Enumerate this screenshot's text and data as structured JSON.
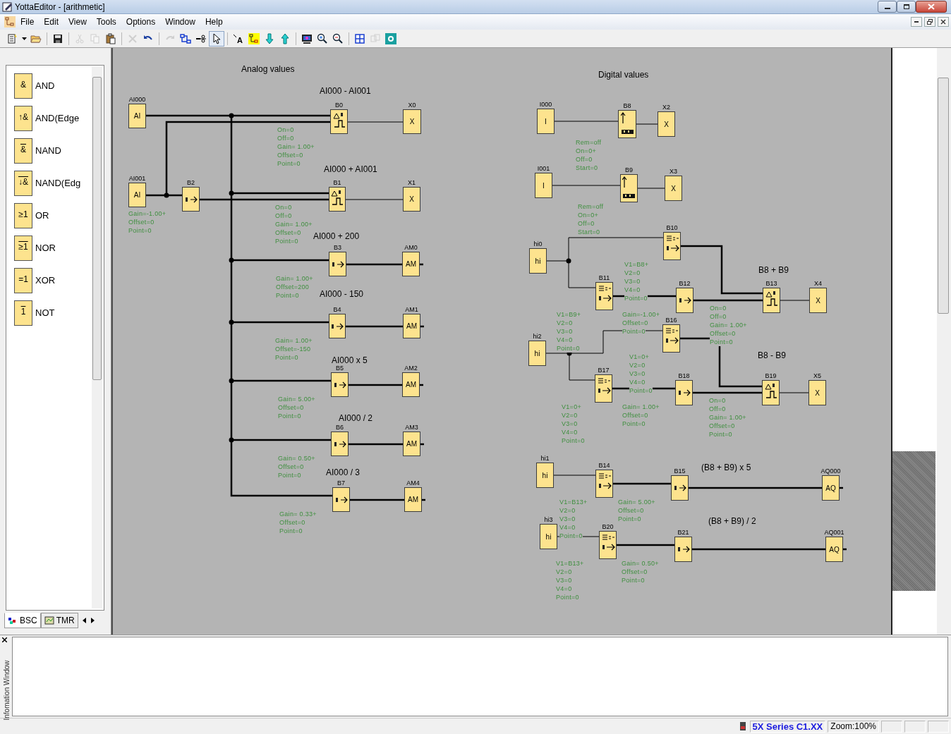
{
  "window": {
    "title": "YottaEditor - [arithmetic]"
  },
  "menu": [
    "File",
    "Edit",
    "View",
    "Tools",
    "Options",
    "Window",
    "Help"
  ],
  "toolbar": [
    {
      "kind": "new",
      "disabled": false
    },
    {
      "kind": "open",
      "disabled": false
    },
    {
      "kind": "save",
      "disabled": false
    },
    {
      "kind": "cut",
      "disabled": true
    },
    {
      "kind": "copy",
      "disabled": true
    },
    {
      "kind": "paste",
      "disabled": false
    },
    {
      "kind": "delete",
      "disabled": true
    },
    {
      "kind": "undo",
      "disabled": false
    },
    {
      "kind": "redo",
      "disabled": true
    },
    {
      "kind": "connect",
      "disabled": false
    },
    {
      "kind": "wirecut",
      "disabled": false
    },
    {
      "kind": "pointer",
      "disabled": false,
      "selected": true
    },
    {
      "kind": "text",
      "disabled": false,
      "glyph": "A"
    },
    {
      "kind": "block",
      "disabled": false
    },
    {
      "kind": "download",
      "disabled": false
    },
    {
      "kind": "upload",
      "disabled": false
    },
    {
      "kind": "monitor",
      "disabled": false
    },
    {
      "kind": "zoomin",
      "disabled": false
    },
    {
      "kind": "zoomout",
      "disabled": false
    },
    {
      "kind": "grid",
      "disabled": false
    },
    {
      "kind": "simulate",
      "disabled": true
    },
    {
      "kind": "settings",
      "disabled": false
    }
  ],
  "palette": {
    "items": [
      {
        "symbol": "&",
        "label": "AND",
        "negated": false
      },
      {
        "symbol": "↑&",
        "label": "AND(Edge",
        "negated": false
      },
      {
        "symbol": "&",
        "label": "NAND",
        "negated": true
      },
      {
        "symbol": "↓&",
        "label": "NAND(Edg",
        "negated": true
      },
      {
        "symbol": "≥1",
        "label": "OR",
        "negated": false
      },
      {
        "symbol": "≥1",
        "label": "NOR",
        "negated": true
      },
      {
        "symbol": "=1",
        "label": "XOR",
        "negated": false
      },
      {
        "symbol": "1",
        "label": "NOT",
        "negated": true
      }
    ],
    "tabs": [
      {
        "label": "BSC",
        "selected": true
      },
      {
        "label": "TMR",
        "selected": false
      }
    ]
  },
  "canvas": {
    "headings": [
      "Analog values",
      "AI000 - AI001",
      "AI000 + AI001",
      "AI000 + 200",
      "AI000 - 150",
      "AI000 x  5",
      "AI000 / 2",
      "AI000 / 3",
      "Digital values",
      "B8 + B9",
      "B8 - B9",
      "(B8 + B9) x 5",
      "(B8 + B9) / 2"
    ],
    "blocks": [
      {
        "label": "AI000",
        "kind": "input",
        "text": "AI"
      },
      {
        "label": "B0",
        "kind": "threshold"
      },
      {
        "label": "X0",
        "kind": "output",
        "text": "X"
      },
      {
        "label": "AI001",
        "kind": "input",
        "text": "AI"
      },
      {
        "label": "B2",
        "kind": "amplifier"
      },
      {
        "label": "B1",
        "kind": "threshold"
      },
      {
        "label": "X1",
        "kind": "output",
        "text": "X"
      },
      {
        "label": "B3",
        "kind": "amplifier"
      },
      {
        "label": "AM0",
        "kind": "output",
        "text": "AM"
      },
      {
        "label": "B4",
        "kind": "amplifier"
      },
      {
        "label": "AM1",
        "kind": "output",
        "text": "AM"
      },
      {
        "label": "B5",
        "kind": "amplifier"
      },
      {
        "label": "AM2",
        "kind": "output",
        "text": "AM"
      },
      {
        "label": "B6",
        "kind": "amplifier"
      },
      {
        "label": "AM3",
        "kind": "output",
        "text": "AM"
      },
      {
        "label": "B7",
        "kind": "amplifier"
      },
      {
        "label": "AM4",
        "kind": "output",
        "text": "AM"
      },
      {
        "label": "I000",
        "kind": "input",
        "text": "I"
      },
      {
        "label": "B8",
        "kind": "counter"
      },
      {
        "label": "X2",
        "kind": "output",
        "text": "X"
      },
      {
        "label": "I001",
        "kind": "input",
        "text": "I"
      },
      {
        "label": "B9",
        "kind": "counter"
      },
      {
        "label": "X3",
        "kind": "output",
        "text": "X"
      },
      {
        "label": "hi0",
        "kind": "input",
        "text": "hi"
      },
      {
        "label": "B10",
        "kind": "multiplexer"
      },
      {
        "label": "B11",
        "kind": "multiplexer"
      },
      {
        "label": "B12",
        "kind": "amplifier"
      },
      {
        "label": "B13",
        "kind": "threshold"
      },
      {
        "label": "X4",
        "kind": "output",
        "text": "X"
      },
      {
        "label": "hi2",
        "kind": "input",
        "text": "hi"
      },
      {
        "label": "B16",
        "kind": "multiplexer"
      },
      {
        "label": "B17",
        "kind": "multiplexer"
      },
      {
        "label": "B18",
        "kind": "amplifier"
      },
      {
        "label": "B19",
        "kind": "threshold"
      },
      {
        "label": "X5",
        "kind": "output",
        "text": "X"
      },
      {
        "label": "hi1",
        "kind": "input",
        "text": "hi"
      },
      {
        "label": "B14",
        "kind": "multiplexer"
      },
      {
        "label": "B15",
        "kind": "amplifier"
      },
      {
        "label": "AQ000",
        "kind": "output",
        "text": "AQ"
      },
      {
        "label": "hi3",
        "kind": "input",
        "text": "hi"
      },
      {
        "label": "B20",
        "kind": "multiplexer"
      },
      {
        "label": "B21",
        "kind": "amplifier"
      },
      {
        "label": "AQ001",
        "kind": "output",
        "text": "AQ"
      }
    ],
    "params": [
      {
        "lines": [
          "On=0",
          "Off=0",
          "Gain= 1.00+",
          "Offset=0",
          "Point=0"
        ]
      },
      {
        "lines": [
          "Gain=-1.00+",
          "Offset=0",
          "Point=0"
        ]
      },
      {
        "lines": [
          "On=0",
          "Off=0",
          "Gain= 1.00+",
          "Offset=0",
          "Point=0"
        ]
      },
      {
        "lines": [
          "Gain= 1.00+",
          "Offset=200",
          "Point=0"
        ]
      },
      {
        "lines": [
          "Gain= 1.00+",
          "Offset=-150",
          "Point=0"
        ]
      },
      {
        "lines": [
          "Gain= 5.00+",
          "Offset=0",
          "Point=0"
        ]
      },
      {
        "lines": [
          "Gain= 0.50+",
          "Offset=0",
          "Point=0"
        ]
      },
      {
        "lines": [
          "Gain= 0.33+",
          "Offset=0",
          "Point=0"
        ]
      },
      {
        "lines": [
          "Rem=off",
          "On=0+",
          "Off=0",
          "Start=0"
        ]
      },
      {
        "lines": [
          "Rem=off",
          "On=0+",
          "Off=0",
          "Start=0"
        ]
      },
      {
        "lines": [
          "V1=B8+",
          "V2=0",
          "V3=0",
          "V4=0",
          "Point=0"
        ]
      },
      {
        "lines": [
          "Gain=-1.00+",
          "Offset=0",
          "Point=0"
        ]
      },
      {
        "lines": [
          "On=0",
          "Off=0",
          "Gain= 1.00+",
          "Offset=0",
          "Point=0"
        ]
      },
      {
        "lines": [
          "V1=B9+",
          "V2=0",
          "V3=0",
          "V4=0",
          "Point=0"
        ]
      },
      {
        "lines": [
          "V1=0+",
          "V2=0",
          "V3=0",
          "V4=0",
          "Point=0"
        ]
      },
      {
        "lines": [
          "Gain= 1.00+",
          "Offset=0",
          "Point=0"
        ]
      },
      {
        "lines": [
          "On=0",
          "Off=0",
          "Gain= 1.00+",
          "Offset=0",
          "Point=0"
        ]
      },
      {
        "lines": [
          "V1=0+",
          "V2=0",
          "V3=0",
          "V4=0",
          "Point=0"
        ]
      },
      {
        "lines": [
          "V1=B13+",
          "V2=0",
          "V3=0",
          "V4=0",
          "Point=0"
        ]
      },
      {
        "lines": [
          "Gain= 5.00+",
          "Offset=0",
          "Point=0"
        ]
      },
      {
        "lines": [
          "V1=B13+",
          "V2=0",
          "V3=0",
          "V4=0",
          "Point=0"
        ]
      },
      {
        "lines": [
          "Gain= 0.50+",
          "Offset=0",
          "Point=0"
        ]
      }
    ]
  },
  "info_window": {
    "title": "Infomation Window"
  },
  "status_bar": {
    "device": "5X Series C1.XX",
    "zoom": "Zoom:100%"
  }
}
